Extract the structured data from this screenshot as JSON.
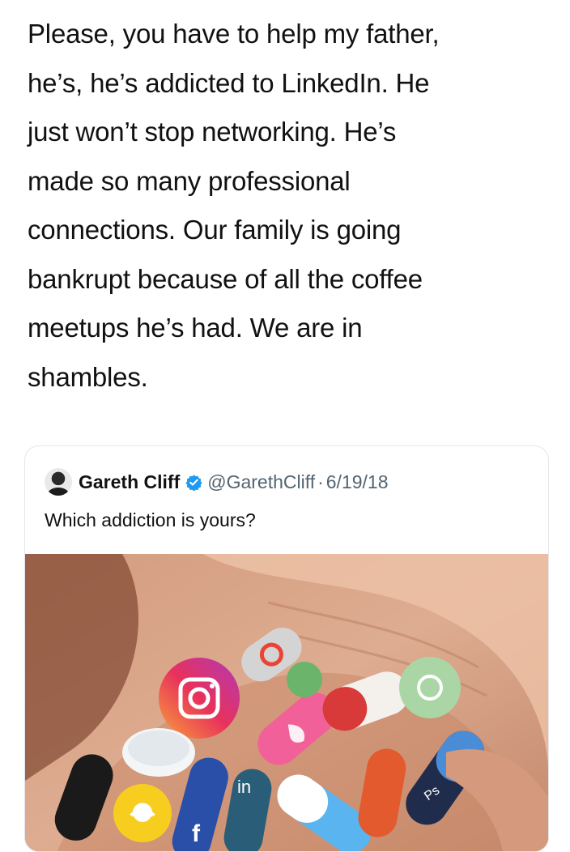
{
  "tweet": {
    "text": "Please, you have to help my father,\nhe’s, he’s addicted to LinkedIn. He\njust won’t stop networking. He’s\nmade so many professional\nconnections. Our family is going\nbankrupt because of all the coffee\nmeetups he’s had. We are in\nshambles."
  },
  "quoted_tweet": {
    "author_name": "Gareth Cliff",
    "handle": "@GarethCliff",
    "separator": "·",
    "date": "6/19/18",
    "text": "Which addiction is yours?",
    "image_labels": {
      "linkedin": "in",
      "facebook": "f",
      "photoshop": "Ps"
    }
  },
  "colors": {
    "verified": "#1d9bf0",
    "muted_text": "#536471",
    "card_border": "#e3e6e8"
  },
  "icons": [
    "verified-badge-icon",
    "instagram-icon",
    "facebook-icon",
    "linkedin-icon",
    "twitter-icon",
    "whatsapp-icon",
    "snapchat-icon",
    "photoshop-icon",
    "tinder-icon"
  ]
}
